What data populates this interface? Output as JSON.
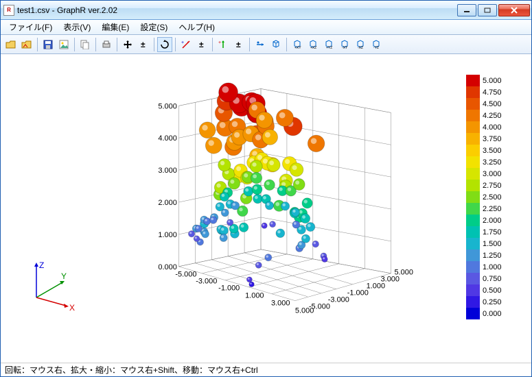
{
  "window": {
    "title": "test1.csv - GraphR ver.2.02",
    "icon_text": "R"
  },
  "menu": {
    "file": "ファイル(F)",
    "view": "表示(V)",
    "edit": "編集(E)",
    "settings": "設定(S)",
    "help": "ヘルプ(H)"
  },
  "toolbar": {
    "open": "open-icon",
    "open_recent": "open-recent-icon",
    "save": "save-icon",
    "save_image": "save-image-icon",
    "copy": "copy-icon",
    "print": "print-icon",
    "pan": "move-icon",
    "pan_reset": "pan-reset-icon",
    "rotate": "rotate-icon",
    "axis_x": "axis-x-icon",
    "axis_x_r": "axis-x-reset-icon",
    "axis_y": "axis-y-icon",
    "axis_y_r": "axis-y-reset-icon",
    "axis_z": "axis-z-icon",
    "cube1": "view-xy-icon",
    "cube2": "view-xz-icon",
    "cube3": "view-yz-icon",
    "cube4": "view-neg-xy-icon",
    "cube5": "view-neg-xz-icon",
    "cube6": "view-neg-yz-icon"
  },
  "chart_data": {
    "type": "scatter",
    "title": "",
    "xlabel": "X",
    "ylabel": "Y",
    "zlabel": "Z",
    "x_range": [
      -5.0,
      5.0
    ],
    "y_range": [
      -5.0,
      5.0
    ],
    "z_range": [
      0.0,
      5.0
    ],
    "x_ticks": [
      "-5.000",
      "-3.000",
      "-1.000",
      "1.000",
      "3.000",
      "5.000"
    ],
    "y_ticks": [
      "-5.000",
      "-3.000",
      "-1.000",
      "1.000",
      "3.000",
      "5.000"
    ],
    "z_ticks": [
      "0.000",
      "1.000",
      "2.000",
      "3.000",
      "4.000",
      "5.000"
    ],
    "color_axis": {
      "min": 0.0,
      "max": 5.0,
      "step": 0.25,
      "labels": [
        "5.000",
        "4.750",
        "4.500",
        "4.250",
        "4.000",
        "3.750",
        "3.500",
        "3.250",
        "3.000",
        "2.750",
        "2.500",
        "2.250",
        "2.000",
        "1.750",
        "1.500",
        "1.250",
        "1.000",
        "0.750",
        "0.500",
        "0.250",
        "0.000"
      ],
      "colors": [
        "#d40000",
        "#e03600",
        "#e85600",
        "#ef7600",
        "#f49500",
        "#f8b200",
        "#fbce00",
        "#f2e200",
        "#d6e500",
        "#b3e300",
        "#80dd15",
        "#40d74a",
        "#00cd88",
        "#00c2b2",
        "#18b5ce",
        "#4097d8",
        "#5078de",
        "#5a58e2",
        "#5038e4",
        "#3018e4",
        "#0000d8"
      ]
    },
    "axes_indicator": {
      "x": "X",
      "y": "Y",
      "z": "Z"
    },
    "points_note": "approx 100–120 spheres, size & color proportional to z-value"
  },
  "status": {
    "text": "回転：マウス右、拡大・縮小：マウス右+Shift、移動：マウス右+Ctrl"
  }
}
